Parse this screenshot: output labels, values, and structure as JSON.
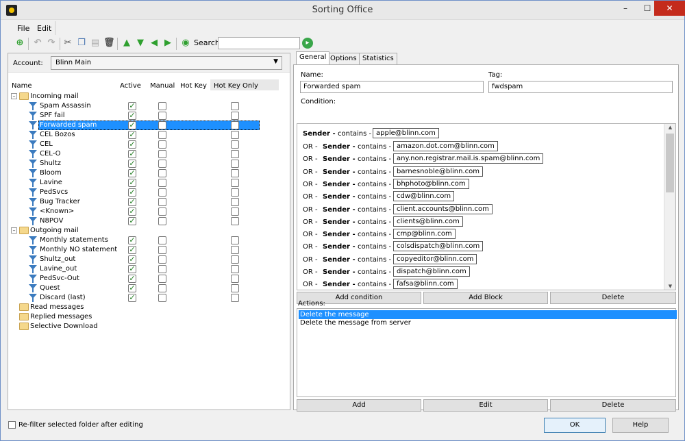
{
  "window": {
    "title": "Sorting Office",
    "min": "–",
    "max": "☐",
    "close": "✕"
  },
  "menu": [
    {
      "label": "File"
    },
    {
      "label": "Edit"
    }
  ],
  "toolbar": {
    "search_label": "Search",
    "search_value": "",
    "icons": [
      "new-filter-icon",
      "undo-icon",
      "redo-icon",
      "cut-icon",
      "copy-icon",
      "paste-icon",
      "delete-icon",
      "move-up-icon",
      "move-down-icon",
      "move-left-icon",
      "move-right-icon",
      "search-back-icon",
      "search-go-icon"
    ]
  },
  "account": {
    "label": "Account:",
    "value": "Blinn Main"
  },
  "columns": {
    "name": "Name",
    "active": "Active",
    "manual": "Manual",
    "hotkey": "Hot Key",
    "hotkey_only": "Hot Key Only"
  },
  "tree": {
    "incoming": {
      "label": "Incoming mail",
      "items": [
        {
          "label": "Spam Assassin",
          "active": true
        },
        {
          "label": "SPF fail",
          "active": true
        },
        {
          "label": "Forwarded spam",
          "active": true,
          "selected": true
        },
        {
          "label": "CEL Bozos",
          "active": true
        },
        {
          "label": "CEL",
          "active": true
        },
        {
          "label": "CEL-O",
          "active": true
        },
        {
          "label": "Shultz",
          "active": true
        },
        {
          "label": "Bloom",
          "active": true
        },
        {
          "label": "Lavine",
          "active": true
        },
        {
          "label": "PedSvcs",
          "active": true
        },
        {
          "label": "Bug Tracker",
          "active": true
        },
        {
          "label": "<Known>",
          "active": true
        },
        {
          "label": "N8POV",
          "active": true
        }
      ]
    },
    "outgoing": {
      "label": "Outgoing mail",
      "items": [
        {
          "label": "Monthly statements",
          "active": true
        },
        {
          "label": "Monthly NO statement",
          "active": true
        },
        {
          "label": "Shultz_out",
          "active": true
        },
        {
          "label": "Lavine_out",
          "active": true
        },
        {
          "label": "PedSvc-Out",
          "active": true
        },
        {
          "label": "Quest",
          "active": true
        },
        {
          "label": "Discard (last)",
          "active": true
        }
      ]
    },
    "others": [
      {
        "label": "Read messages"
      },
      {
        "label": "Replied messages"
      },
      {
        "label": "Selective Download"
      }
    ]
  },
  "tabs": [
    {
      "label": "General"
    },
    {
      "label": "Options"
    },
    {
      "label": "Statistics"
    }
  ],
  "general": {
    "name_label": "Name:",
    "name_value": "Forwarded spam",
    "tag_label": "Tag:",
    "tag_value": "fwdspam",
    "condition_label": "Condition:"
  },
  "conditions": {
    "first": {
      "field": "Sender -",
      "op": "contains -",
      "value": "apple@blinn.com"
    },
    "rest_prefix": "OR -",
    "rest_field": "Sender -",
    "rest_op": "contains -",
    "values": [
      "amazon.dot.com@blinn.com",
      "any.non.registrar.mail.is.spam@blinn.com",
      "barnesnoble@blinn.com",
      "bhphoto@blinn.com",
      "cdw@blinn.com",
      "client.accounts@blinn.com",
      "clients@blinn.com",
      "cmp@blinn.com",
      "colsdispatch@blinn.com",
      "copyeditor@blinn.com",
      "dispatch@blinn.com",
      "fafsa@blinn.com"
    ]
  },
  "condition_buttons": {
    "add_condition": "Add condition",
    "add_block": "Add Block",
    "delete": "Delete"
  },
  "actions": {
    "label": "Actions:",
    "items": [
      {
        "label": "Delete the message",
        "selected": true
      },
      {
        "label": "Delete the message from server"
      }
    ]
  },
  "action_buttons": {
    "add": "Add",
    "edit": "Edit",
    "delete": "Delete"
  },
  "footer": {
    "refilter_label": "Re-filter selected folder after editing",
    "ok": "OK",
    "help": "Help"
  }
}
